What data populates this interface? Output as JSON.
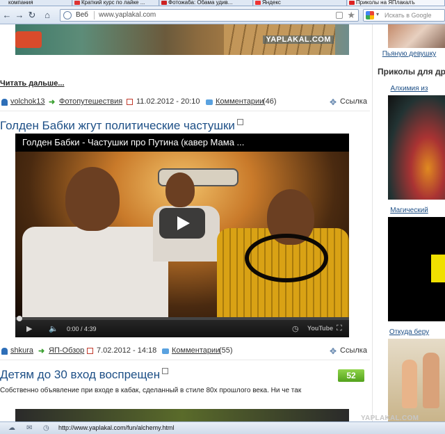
{
  "tabs": [
    {
      "label": "компания",
      "color": "#cfd8e3"
    },
    {
      "label": "Краткий курс по лайке ...",
      "color": "#d33"
    },
    {
      "label": "Фотожаба: Обама удив...",
      "color": "#c22"
    },
    {
      "label": "Яндекс",
      "color": "#e33"
    },
    {
      "label": "Приколы на ЯПлакалъ",
      "color": "#d22"
    }
  ],
  "toolbar": {
    "mode": "Веб",
    "url": "www.yaplakal.com",
    "search_placeholder": "Искать в Google"
  },
  "main": {
    "top_image_watermark": "YAPLAKAL.COM",
    "read_more": "Читать дальше...",
    "post1": {
      "author": "volchok13",
      "section": "Фотопутешествия",
      "date": "11.02.2012 - 20:10",
      "comments": "Комментарии",
      "comments_count": "(46)",
      "link": "Ссылка"
    },
    "post2": {
      "title": "Голден Бабки жгут политические частушки",
      "video_title": "Голден Бабки - Частушки про Путина (кавер Мама ...",
      "time": "0:00 / 4:39",
      "yt_logo": "YouTube",
      "author": "shkura",
      "section": "ЯП-Обзор",
      "date": "7.02.2012 - 14:18",
      "comments": "Комментарии",
      "comments_count": "(55)",
      "link": "Ссылка",
      "progress_fraction": 0.0
    },
    "post3": {
      "title": "Детям до 30 вход воспрещен",
      "rating": "52",
      "description": "Собственно объявление при входе в кабак, сделанный в стиле 80х прошлого века. Ни че так"
    }
  },
  "sidebar": {
    "top_link": "Пьяную девушку",
    "heading": "Приколы для др",
    "item1": "Алхимия из",
    "item2": "Магический",
    "item3": "Откуда беру"
  },
  "statusbar": {
    "url": "http://www.yaplakal.com/fun/alchemy.html"
  },
  "watermark": "YAPLAKAL.COM"
}
